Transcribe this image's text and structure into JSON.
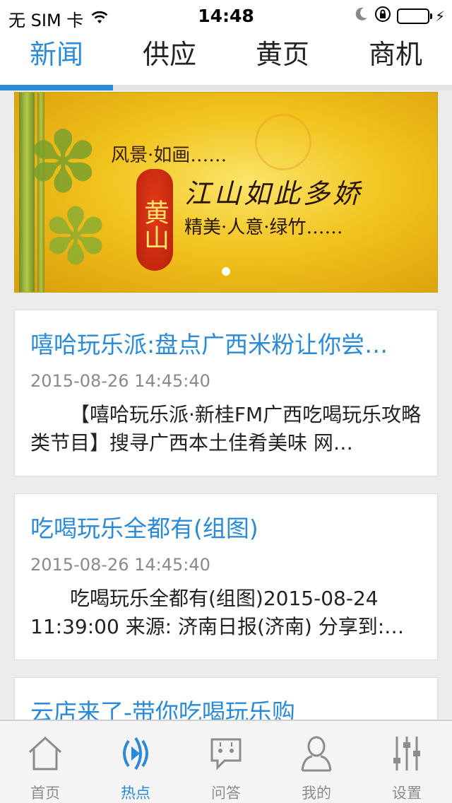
{
  "status_bar": {
    "carrier": "无 SIM 卡",
    "time": "14:48"
  },
  "top_tabs": [
    {
      "label": "新闻",
      "active": true
    },
    {
      "label": "供应",
      "active": false
    },
    {
      "label": "黄页",
      "active": false
    },
    {
      "label": "商机",
      "active": false
    }
  ],
  "banner": {
    "line1": "风景·如画……",
    "seal": "黄山",
    "line2": "江山如此多娇",
    "line3": "精美·人意·绿竹……",
    "page_indicator": {
      "current": 1,
      "total": 1
    }
  },
  "news": [
    {
      "title": "嘻哈玩乐派:盘点广西米粉让你尝…",
      "time": "2015-08-26 14:45:40",
      "summary": "【嘻哈玩乐派·新桂FM广西吃喝玩乐攻略类节目】搜寻广西本土佳肴美味 网…"
    },
    {
      "title": "吃喝玩乐全都有(组图)",
      "time": "2015-08-26 14:45:40",
      "summary": "吃喝玩乐全都有(组图)2015-08-24 11:39:00 来源: 济南日报(济南) 分享到:…"
    },
    {
      "title": "云店来了-带你吃喝玩乐购",
      "time": "",
      "summary": ""
    }
  ],
  "bottom_tabs": [
    {
      "label": "首页",
      "icon": "home-icon",
      "active": false
    },
    {
      "label": "热点",
      "icon": "hotspot-icon",
      "active": true
    },
    {
      "label": "问答",
      "icon": "qa-chat-icon",
      "active": false
    },
    {
      "label": "我的",
      "icon": "user-icon",
      "active": false
    },
    {
      "label": "设置",
      "icon": "settings-sliders-icon",
      "active": false
    }
  ],
  "colors": {
    "accent": "#2b8ad8",
    "background": "#ececec",
    "inactive": "#8c8c8c"
  }
}
